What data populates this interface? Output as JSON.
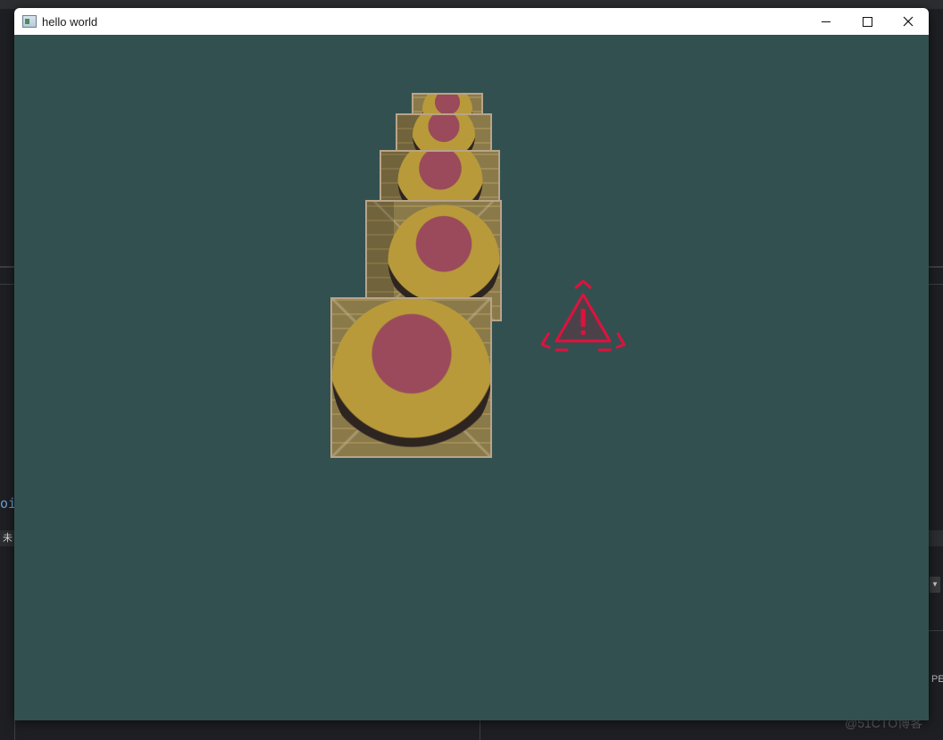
{
  "window": {
    "title": "hello world",
    "controls": {
      "minimize": "minimize",
      "maximize": "maximize",
      "close": "close"
    }
  },
  "background_ide": {
    "code_fragment": "oi",
    "tab_fragment": "未",
    "right_label": "PE"
  },
  "watermark": "@51CTO博客",
  "colors": {
    "viewport_bg": "#335050",
    "warning": "#e0113e",
    "crate_frame": "#b9a488"
  },
  "scene": {
    "object": "stack of textured crates",
    "crate_count": 5
  },
  "icons": {
    "warning": "warning-triangle-icon",
    "app": "app-window-icon"
  }
}
